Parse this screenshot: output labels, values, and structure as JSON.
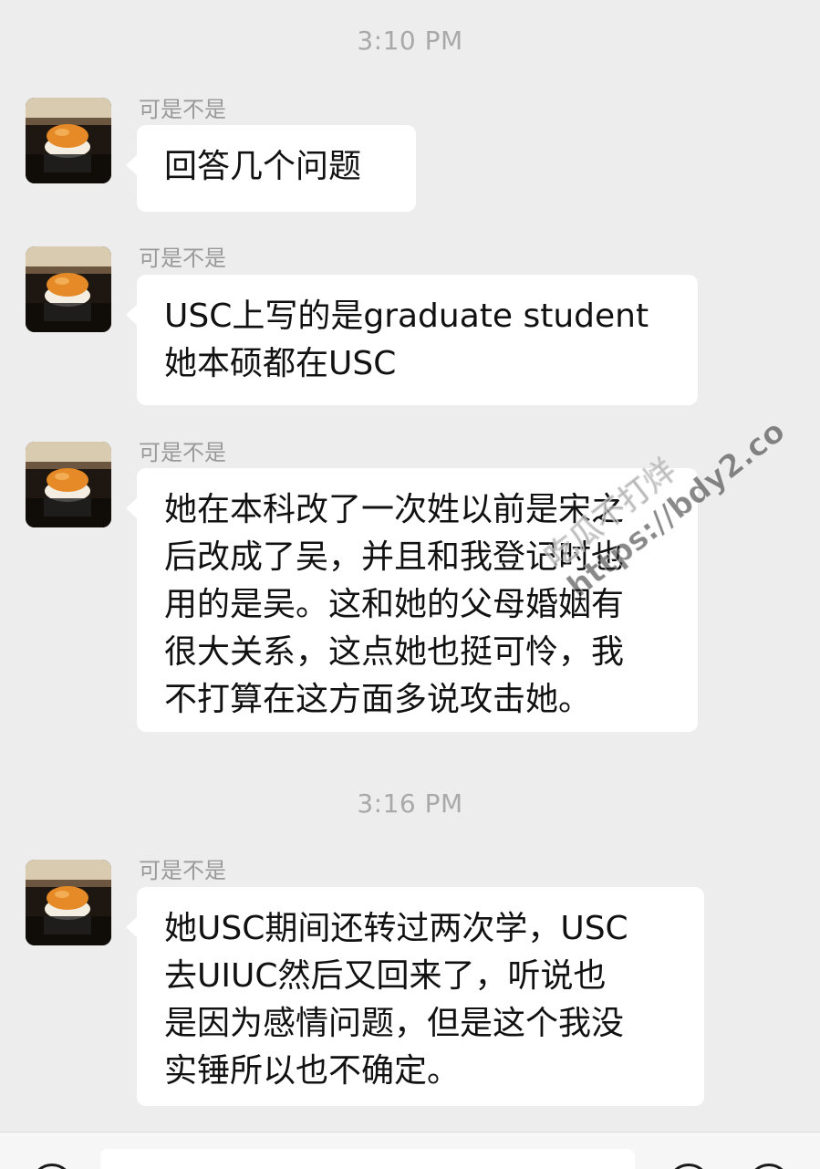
{
  "messages": [
    {
      "type": "time",
      "text": "3:10 PM"
    },
    {
      "type": "msg",
      "sender": "可是不是",
      "text": "回答几个问题"
    },
    {
      "type": "msg",
      "sender": "可是不是",
      "text": "USC上写的是graduate student\n她本硕都在USC"
    },
    {
      "type": "msg",
      "sender": "可是不是",
      "text": "她在本科改了一次姓以前是宋之\n后改成了吴，并且和我登记时也\n用的是吴。这和她的父母婚姻有\n很大关系，这点她也挺可怜，我\n不打算在这方面多说攻击她。"
    },
    {
      "type": "time",
      "text": "3:16 PM"
    },
    {
      "type": "msg",
      "sender": "可是不是",
      "text": "她USC期间还转过两次学，USC\n去UIUC然后又回来了，听说也\n是因为感情问题，但是这个我没\n实锤所以也不确定。"
    }
  ],
  "watermark": {
    "line1": "吃瓜不打烊",
    "line2": "https://bdy2.co"
  },
  "colors": {
    "background": "#ededed",
    "bubble": "#ffffff",
    "text": "#111111",
    "meta": "#9a9a9a"
  },
  "icons": {
    "voice": "voice-icon",
    "emoji": "emoji-icon",
    "add": "add-icon"
  }
}
